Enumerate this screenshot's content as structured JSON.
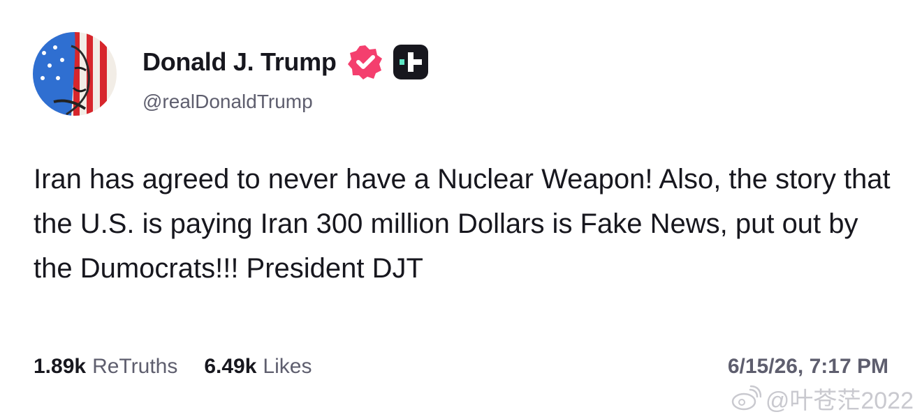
{
  "profile": {
    "display_name": "Donald J. Trump",
    "handle": "@realDonaldTrump"
  },
  "post": {
    "text": "Iran has agreed to never have a Nuclear Weapon! Also, the story that the U.S. is paying Iran 300 million Dollars is Fake News, put out by the Dumocrats!!! President DJT"
  },
  "stats": {
    "retruths_count": "1.89k",
    "retruths_label": "ReTruths",
    "likes_count": "6.49k",
    "likes_label": "Likes"
  },
  "timestamp": "6/15/26, 7:17 PM",
  "watermark": {
    "text": "@叶苍茫2022"
  },
  "colors": {
    "text_primary": "#17171e",
    "text_secondary": "#5e5e6e",
    "verified_badge": "#f43f6e",
    "plus_badge_bg": "#17171e",
    "plus_badge_accent": "#5ee6c4"
  },
  "icons": [
    "avatar",
    "verified-badge-icon",
    "plus-badge-icon",
    "weibo-logo-icon"
  ]
}
